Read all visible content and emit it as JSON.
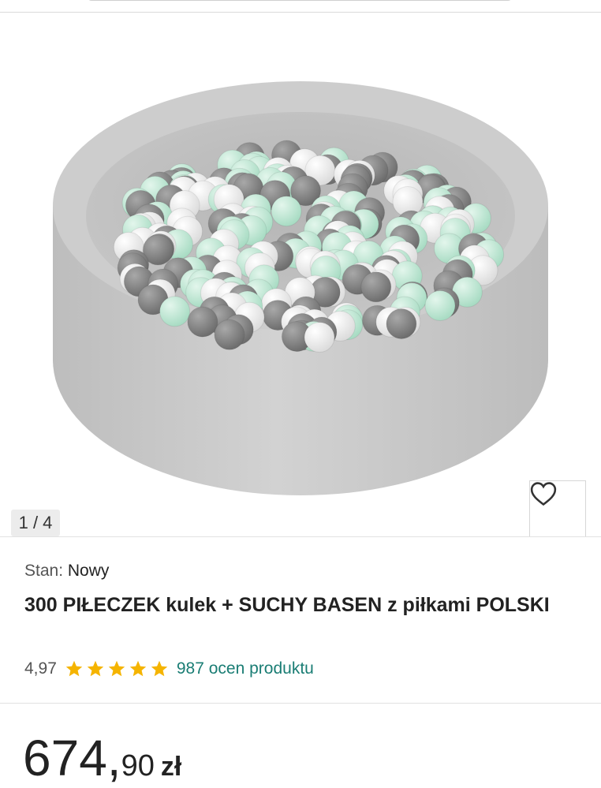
{
  "gallery": {
    "counter": "1 / 4",
    "favorite_icon": "heart-icon",
    "product_image": "grey round dry ball pit with mint, white and grey balls"
  },
  "product": {
    "condition_label": "Stan:",
    "condition_value": "Nowy",
    "title": "300 PIŁECZEK kulek + SUCHY BASEN z piłkami POLSKI",
    "rating_value": "4,97",
    "stars": 5,
    "rating_count": "987 ocen produktu",
    "price_main": "674,",
    "price_cents": "90",
    "currency": "zł"
  },
  "colors": {
    "accent_link": "#1a7d74",
    "star": "#f5b400",
    "pit": "#c9c9c9",
    "ball_mint": "#b9e6d0",
    "ball_white": "#f3f3f3",
    "ball_grey": "#8a8a8a"
  }
}
